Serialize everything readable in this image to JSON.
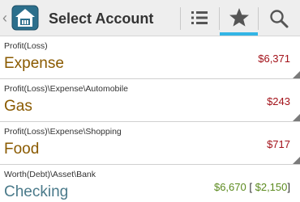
{
  "action_bar": {
    "title": "Select Account",
    "icons": {
      "up": "chevron-left-icon",
      "app": "house-app-icon",
      "list": "list-icon",
      "favorites": "star-icon",
      "search": "search-icon"
    },
    "colors": {
      "background": "#eeeeee",
      "accent": "#33b5e5",
      "icon": "#555555"
    }
  },
  "accounts": [
    {
      "path": "Profit(Loss)",
      "name": "Expense",
      "amount": "$6,371",
      "amount_color": "#a3121a"
    },
    {
      "path": "Profit(Loss)\\Expense\\Automobile",
      "name": "Gas",
      "amount": "$243",
      "amount_color": "#a3121a"
    },
    {
      "path": "Profit(Loss)\\Expense\\Shopping",
      "name": "Food",
      "amount": "$717",
      "amount_color": "#a3121a"
    },
    {
      "path": "Worth(Debt)\\Asset\\Bank",
      "name": "Checking",
      "amount": "$6,670",
      "secondary_amount": "$2,150",
      "amount_color": "#5b8a1e"
    }
  ]
}
